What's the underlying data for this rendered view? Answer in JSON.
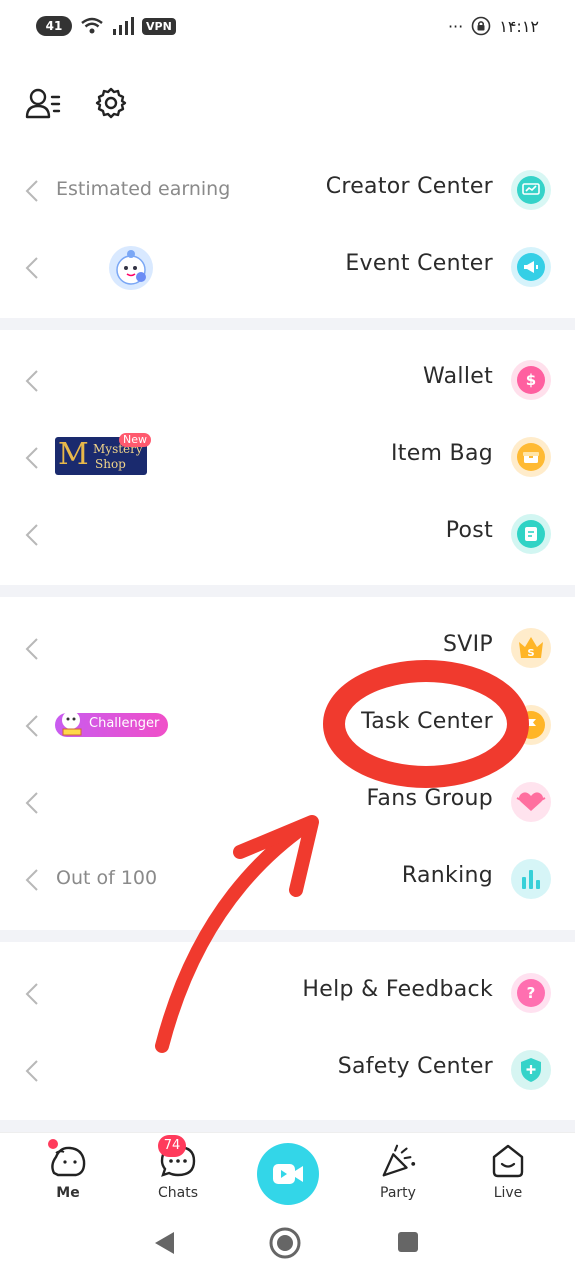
{
  "status_bar": {
    "battery": "41",
    "vpn": "VPN",
    "dots": "···",
    "time": "۱۴:۱۲"
  },
  "sections": [
    {
      "rows": [
        {
          "label": "Creator Center",
          "hint": "Estimated earning",
          "icon": "chart-icon",
          "color": "#35d3c9"
        },
        {
          "label": "Event Center",
          "hint": "",
          "icon": "megaphone-icon",
          "color": "#35cfe6"
        }
      ]
    },
    {
      "rows": [
        {
          "label": "Wallet",
          "hint": "",
          "icon": "dollar-icon",
          "color": "#ff5fa0"
        },
        {
          "label": "Item Bag",
          "hint": "",
          "icon": "bag-icon",
          "color": "#ffba33"
        },
        {
          "label": "Post",
          "hint": "",
          "icon": "post-icon",
          "color": "#2fd3c5"
        }
      ]
    },
    {
      "rows": [
        {
          "label": "SVIP",
          "hint": "",
          "icon": "crown-icon",
          "color": "#ffb527"
        },
        {
          "label": "Task Center",
          "hint": "",
          "icon": "flag-icon",
          "color": "#ffb527"
        },
        {
          "label": "Fans Group",
          "hint": "",
          "icon": "heart-icon",
          "color": "#ff6f9f"
        },
        {
          "label": "Ranking",
          "hint": "Out of 100",
          "icon": "bar-chart-icon",
          "color": "#37d0d8"
        }
      ]
    },
    {
      "rows": [
        {
          "label": "Help & Feedback",
          "hint": "",
          "icon": "question-icon",
          "color": "#ff6fb0"
        },
        {
          "label": "Safety Center",
          "hint": "",
          "icon": "shield-icon",
          "color": "#35d3c9"
        }
      ]
    }
  ],
  "mystery_shop": {
    "line1": "Mystery",
    "line2": "Shop",
    "letter": "M",
    "new_badge": "New"
  },
  "challenger_badge": "Challenger",
  "bottom_nav": {
    "me": "Me",
    "chats": "Chats",
    "chats_count": "74",
    "party": "Party",
    "live": "Live"
  },
  "colors": {
    "accent": "#33d6e8",
    "annotation": "#f03a2e"
  }
}
